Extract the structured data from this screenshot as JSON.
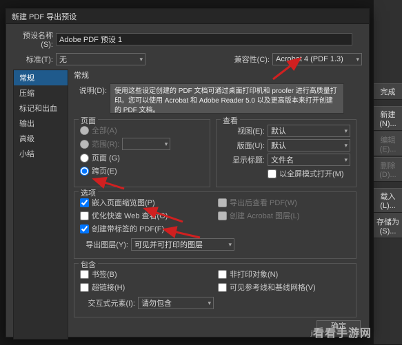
{
  "dialog": {
    "title": "新建 PDF 导出预设",
    "preset_name_label": "预设名称(S):",
    "preset_name_value": "Adobe PDF 预设 1",
    "standard_label": "标准(T):",
    "standard_value": "无",
    "compat_label": "兼容性(C):",
    "compat_value": "Acrobat 4 (PDF 1.3)"
  },
  "sidebar": {
    "items": [
      {
        "label": "常规"
      },
      {
        "label": "压缩"
      },
      {
        "label": "标记和出血"
      },
      {
        "label": "输出"
      },
      {
        "label": "高级"
      },
      {
        "label": "小结"
      }
    ]
  },
  "general": {
    "title": "常规",
    "desc_label": "说明(D):",
    "desc_text": "使用这些设定创建的 PDF 文档可通过桌面打印机和 proofer 进行高质量打印。您可以使用 Acrobat 和 Adobe Reader 5.0 以及更高版本来打开创建的 PDF 文档。"
  },
  "pages": {
    "title": "页面",
    "all": "全部(A)",
    "range_label": "范围(R):",
    "range_value": "",
    "pages_radio": "页面 (G)",
    "spreads_radio": "跨页(E)"
  },
  "view": {
    "title": "查看",
    "view_label": "视图(E):",
    "view_value": "默认",
    "layout_label": "版面(U):",
    "layout_value": "默认",
    "marks_label": "显示标题:",
    "marks_value": "文件名",
    "fullscreen": "以全屏模式打开(M)"
  },
  "options": {
    "title": "选项",
    "embed_thumb": "嵌入页面缩览图(P)",
    "optimize_web": "优化快速 Web 查看(O)",
    "tagged_pdf": "创建带标签的 PDF(F)",
    "layers_label": "导出图层(Y):",
    "layers_value": "可见并可打印的图层",
    "view_after": "导出后查看 PDF(W)",
    "acrobat_layers": "创建 Acrobat 图层(L)"
  },
  "include": {
    "title": "包含",
    "bookmarks": "书签(B)",
    "hyperlinks": "超链接(H)",
    "nonprinting": "非打印对象(N)",
    "guides": "可见参考线和基线网格(V)",
    "interactive_label": "交互式元素(I):",
    "interactive_value": "请勿包含"
  },
  "right_strip": {
    "done": "完成",
    "new": "新建(N)...",
    "edit": "编辑(E)...",
    "delete": "删除(D)...",
    "load": "载入(L)...",
    "save_as": "存储为(S)..."
  },
  "footer": {
    "ok": "确定",
    "wm_small": "ji",
    "watermark": "看看手游网"
  }
}
